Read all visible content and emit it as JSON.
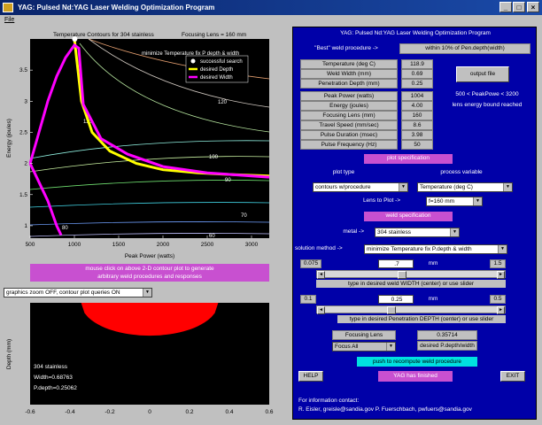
{
  "window": {
    "title": "YAG:  Pulsed Nd:YAG Laser Welding Optimization Program",
    "minimize": "_",
    "maximize": "□",
    "close": "×"
  },
  "menu": {
    "file": "File"
  },
  "top_plot": {
    "title_left": "Temperature  Contours for 304 stainless",
    "title_right": "Focusing Lens = 160 mm",
    "subtitle": "minimize Temperature   fix P depth & width",
    "ylabel": "Energy (joules)",
    "xlabel": "Peak Power  (watts)",
    "legend": [
      "successful search",
      "desired Depth",
      "desired Width"
    ],
    "contour_labels": [
      "120",
      "110",
      "100",
      "90",
      "80",
      "70",
      "60",
      "80"
    ]
  },
  "mouse_note": {
    "line1": "mouse click on above 2-D contour plot to generate",
    "line2": "arbitrary weld procedures and responses"
  },
  "zoom_select": "graphics zoom OFF,  contour plot queries ON",
  "bottom_plot": {
    "ylabel": "Depth  (mm)",
    "info": [
      "304 stainless",
      "Width=0.68763",
      "P.depth=0.25062"
    ]
  },
  "chart_data": [
    {
      "type": "line",
      "title": "Temperature  Contours for 304 stainless",
      "subtitle": "minimize Temperature   fix P depth & width",
      "xlabel": "Peak Power  (watts)",
      "ylabel": "Energy (joules)",
      "xlim": [
        500,
        3200
      ],
      "ylim": [
        0.8,
        4.0
      ],
      "xticks": [
        500,
        1000,
        1500,
        2000,
        2500,
        3000
      ],
      "yticks": [
        1,
        1.5,
        2,
        2.5,
        3,
        3.5
      ],
      "series": [
        {
          "name": "desired Depth",
          "color": "#ffff00",
          "x": [
            1000,
            1080,
            1200,
            1400,
            1700,
            2000,
            2400,
            2800,
            3200
          ],
          "y": [
            4.0,
            3.0,
            2.5,
            2.2,
            2.0,
            1.9,
            1.85,
            1.82,
            1.8
          ]
        },
        {
          "name": "desired Width",
          "color": "#ff00ff",
          "x": [
            500,
            600,
            700,
            800,
            900,
            1000,
            1050,
            1100,
            1300,
            1600,
            2000,
            2500,
            3000,
            3200
          ],
          "y": [
            2.0,
            2.5,
            3.0,
            3.4,
            3.7,
            3.9,
            3.85,
            2.95,
            2.4,
            2.15,
            1.95,
            1.85,
            1.8,
            1.78
          ]
        },
        {
          "name": "desired Width",
          "color": "#ff00ff",
          "x": [
            500,
            600,
            700,
            750,
            800,
            850
          ],
          "y": [
            2.0,
            1.7,
            1.4,
            1.2,
            1.0,
            0.85
          ]
        },
        {
          "name": "successful search",
          "color": "#ffffff",
          "x": [
            1004
          ],
          "y": [
            4.0
          ]
        }
      ],
      "grid": false,
      "legend": "top-right"
    },
    {
      "type": "area",
      "ylabel": "Depth  (mm)",
      "xlim": [
        -0.6,
        0.6
      ],
      "xticks": [
        -0.6,
        -0.4,
        -0.2,
        0,
        0.2,
        0.4,
        0.6
      ],
      "values": {
        "width": 0.68763,
        "depth": 0.25062
      },
      "color": "#ff0000"
    }
  ],
  "right": {
    "title": "YAG:  Pulsed Nd:YAG Laser Welding Optimization Program",
    "best_label": "\"Best\" weld procedure ->",
    "within_label": "within 10% of Pen.depth(width)",
    "results": [
      {
        "label": "Temperature (deg C)",
        "value": "118.9"
      },
      {
        "label": "Weld Width (mm)",
        "value": "0.69"
      },
      {
        "label": "Penetration Depth (mm)",
        "value": "0.25"
      }
    ],
    "output_file": "output file",
    "params": [
      {
        "label": "Peak Power (watts)",
        "value": "1004"
      },
      {
        "label": "Energy (joules)",
        "value": "4.00"
      },
      {
        "label": "Focusing Lens (mm)",
        "value": "160"
      },
      {
        "label": "Travel Speed (mm/sec)",
        "value": "8.6"
      },
      {
        "label": "Pulse Duration (msec)",
        "value": "3.98"
      },
      {
        "label": "Pulse Frequency (Hz)",
        "value": "50"
      }
    ],
    "bound_line1": "500 < PeakPowe  < 3200",
    "bound_line2": "lens energy bound reached",
    "plot_spec": "plot specification",
    "plot_type_label": "plot type",
    "process_var_label": "process variable",
    "plot_type": "contours w/procedure",
    "process_var": "Temperature (deg C)",
    "lens_label": "Lens to Plot ->",
    "lens_value": "f=160 mm",
    "weld_spec": "weld specification",
    "metal_label": "metal ->",
    "metal_value": "304 stainless",
    "solution_label": "solution method ->",
    "solution_value": "minimize Temperature   fix P.depth & width",
    "width_slider": {
      "min": "0.075",
      "value": ".7",
      "unit": "mm",
      "max": "1.5",
      "caption": "type in desired weld WIDTH (center) or use slider"
    },
    "depth_slider": {
      "min": "0.1",
      "value": "0.25",
      "unit": "mm",
      "max": "0.5",
      "caption": "type in desired Penetration DEPTH (center) or use slider"
    },
    "focusing_lens_label": "Focusing Lens",
    "focus_value": "Focus All",
    "ratio_value": "0.35714",
    "ratio_label": "desired P.depth/width",
    "recompute": "push to recompute weld procedure",
    "help": "HELP",
    "status": "YAG has finished",
    "exit": "EXIT",
    "contact_title": "For information contact:",
    "contact": "R. Eisler, greisle@sandia.gov   P. Fuerschbach, pwfuers@sandia.gov"
  }
}
